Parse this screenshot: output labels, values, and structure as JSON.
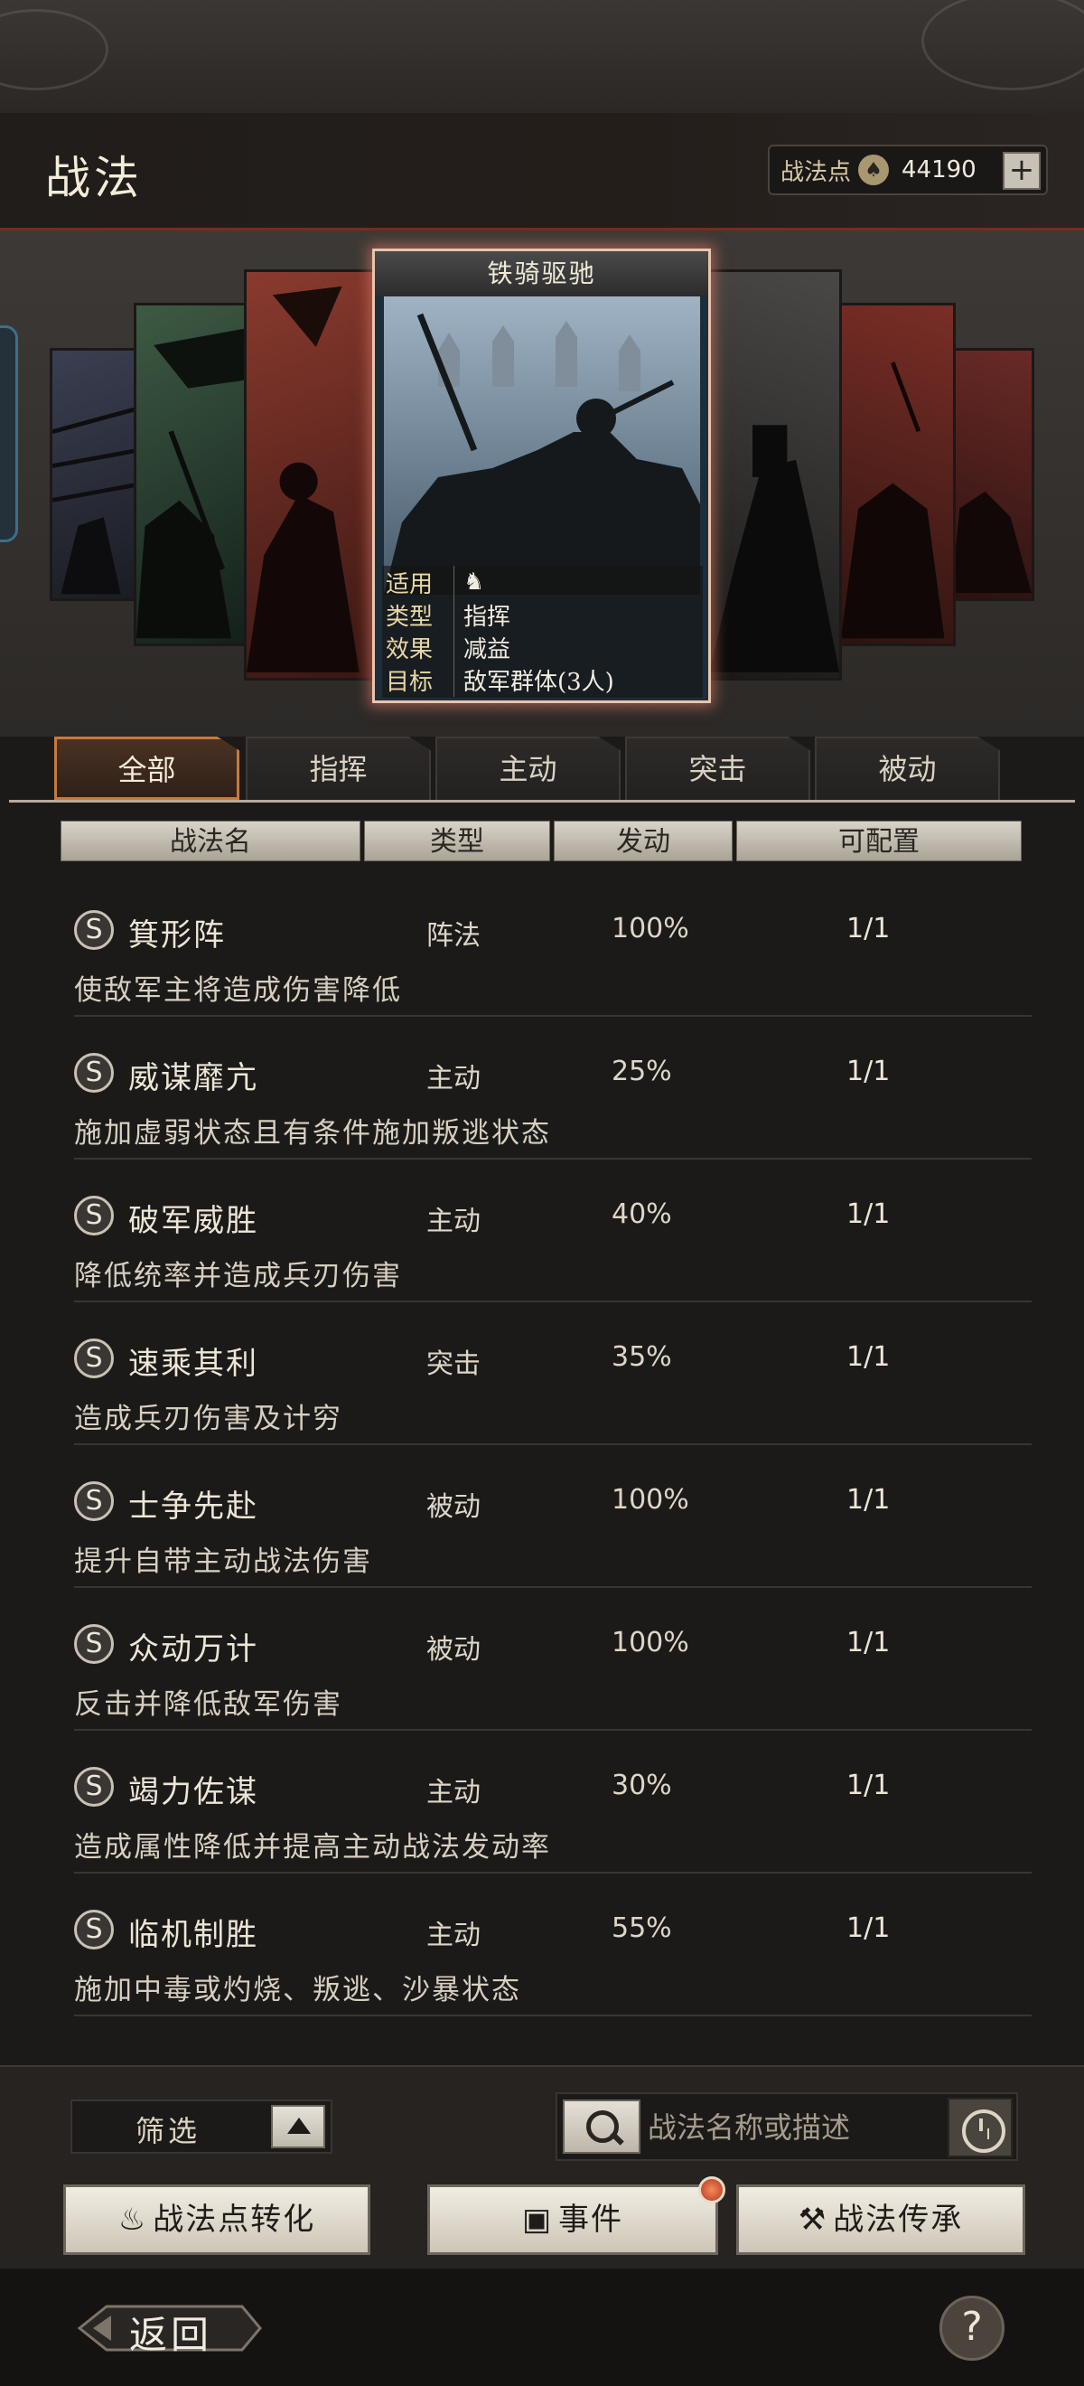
{
  "header": {
    "title": "战法",
    "points_label": "战法点",
    "points_value": "44190",
    "plus_label": "+"
  },
  "featured": {
    "title": "铁骑驱驰",
    "rows": [
      {
        "key": "适用",
        "value": ""
      },
      {
        "key": "类型",
        "value": "指挥"
      },
      {
        "key": "效果",
        "value": "减益"
      },
      {
        "key": "目标",
        "value": "敌军群体(3人)"
      }
    ]
  },
  "tabs": [
    {
      "label": "全部",
      "active": true
    },
    {
      "label": "指挥"
    },
    {
      "label": "主动"
    },
    {
      "label": "突击"
    },
    {
      "label": "被动"
    }
  ],
  "columns": [
    "战法名",
    "类型",
    "发动",
    "可配置"
  ],
  "list": [
    {
      "grade": "S",
      "name": "箕形阵",
      "type": "阵法",
      "rate": "100%",
      "config": "1/1",
      "desc": "使敌军主将造成伤害降低"
    },
    {
      "grade": "S",
      "name": "威谋靡亢",
      "type": "主动",
      "rate": "25%",
      "config": "1/1",
      "desc": "施加虚弱状态且有条件施加叛逃状态"
    },
    {
      "grade": "S",
      "name": "破军威胜",
      "type": "主动",
      "rate": "40%",
      "config": "1/1",
      "desc": "降低统率并造成兵刃伤害"
    },
    {
      "grade": "S",
      "name": "速乘其利",
      "type": "突击",
      "rate": "35%",
      "config": "1/1",
      "desc": "造成兵刃伤害及计穷"
    },
    {
      "grade": "S",
      "name": "士争先赴",
      "type": "被动",
      "rate": "100%",
      "config": "1/1",
      "desc": "提升自带主动战法伤害"
    },
    {
      "grade": "S",
      "name": "众动万计",
      "type": "被动",
      "rate": "100%",
      "config": "1/1",
      "desc": "反击并降低敌军伤害"
    },
    {
      "grade": "S",
      "name": "竭力佐谋",
      "type": "主动",
      "rate": "30%",
      "config": "1/1",
      "desc": "造成属性降低并提高主动战法发动率"
    },
    {
      "grade": "S",
      "name": "临机制胜",
      "type": "主动",
      "rate": "55%",
      "config": "1/1",
      "desc": "施加中毒或灼烧、叛逃、沙暴状态"
    }
  ],
  "bottom": {
    "filter_label": "筛选",
    "search_placeholder": "战法名称或描述",
    "btn_convert": "战法点转化",
    "btn_event": "事件",
    "btn_inherit": "战法传承"
  },
  "footer": {
    "back_label": "返回",
    "help_label": "?"
  },
  "colors": {
    "accent": "#c77a3e",
    "header_line": "#7a2c1d",
    "featured_glow": "#e8c4ae"
  }
}
